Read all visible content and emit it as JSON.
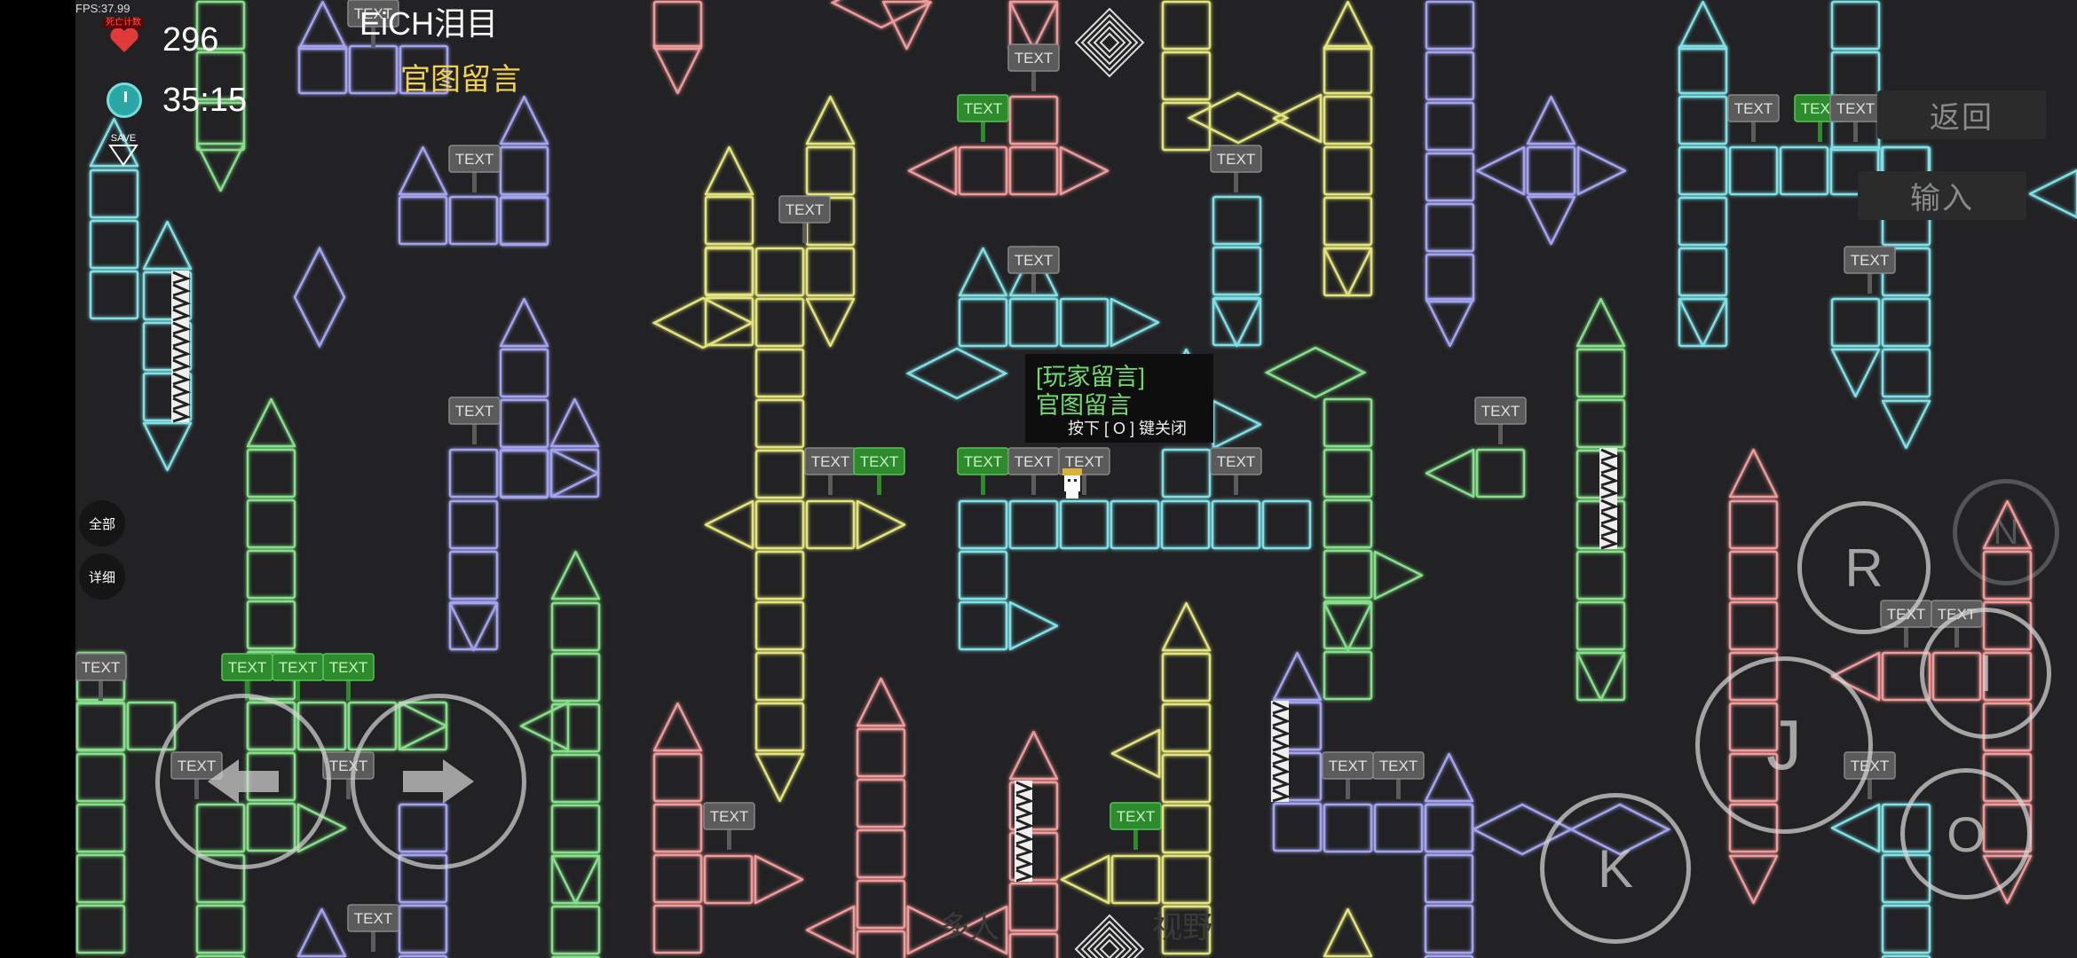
{
  "fps": "FPS:37.99",
  "deaths": {
    "value": "296",
    "badge": "死亡计数"
  },
  "timer": "35:15",
  "save_label": "SAVE",
  "stage_title": "EiCH泪目",
  "stage_subtitle": "官图留言",
  "side_buttons": {
    "all": "全部",
    "detail": "详细"
  },
  "menu": {
    "back": "返回",
    "input": "输入"
  },
  "popup": {
    "line1": "[玩家留言]",
    "line2": "官图留言",
    "hint": "按下 [ O ] 键关闭"
  },
  "sign_text": "TEXT",
  "controls": {
    "r": "R",
    "n": "N",
    "j": "J",
    "i": "I",
    "k": "K",
    "o": "O"
  },
  "faint_texts": [
    "多人",
    "视野"
  ],
  "colors": {
    "yellow": "#e4e47c",
    "green": "#86e08a",
    "cyan": "#7fe0e6",
    "purple": "#a3a3f0",
    "pink": "#f09a9a",
    "sign_gray": "#5b5b5b",
    "sign_green": "#2d8a2d"
  }
}
